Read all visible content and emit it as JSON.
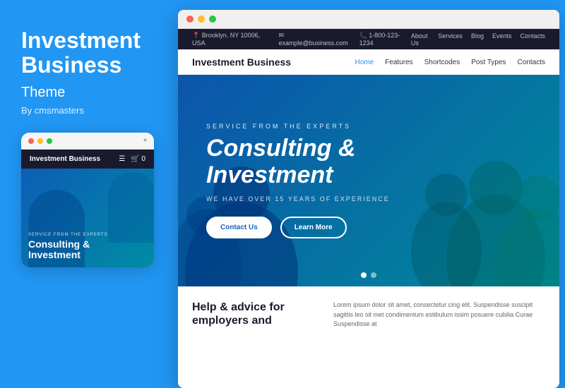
{
  "left": {
    "title": "Investment Business",
    "subtitle": "Theme",
    "by": "By cmsmasters"
  },
  "mobile": {
    "window_dots": [
      "red",
      "yellow",
      "green"
    ],
    "site_logo": "Investment Business",
    "menu_icon": "☰",
    "cart_text": "🛒 0",
    "hero_label": "SERVICE FROM THE EXPERTS",
    "hero_heading_line1": "Consulting &",
    "hero_heading_line2": "Investment"
  },
  "browser": {
    "window_dots": [
      "red",
      "yellow",
      "green"
    ],
    "topbar": {
      "left_items": [
        "📍 Brooklyn, NY 10006, USA",
        "✉ example@business.com",
        "📞 1-800-123-1234"
      ],
      "right_items": [
        "About Us",
        "Services",
        "Blog",
        "Events",
        "Contacts"
      ]
    },
    "nav": {
      "logo": "Investment Business",
      "links": [
        "Home",
        "Features",
        "Shortcodes",
        "Post Types",
        "Contacts"
      ]
    },
    "hero": {
      "label": "SERVICE FROM THE EXPERTS",
      "heading_line1": "Consulting &",
      "heading_line2": "Investment",
      "subtext": "WE HAVE OVER 15 YEARS OF EXPERIENCE",
      "btn_contact": "Contact Us",
      "btn_learn": "Learn More"
    },
    "bottom": {
      "heading": "Help & advice for employers and",
      "body_text": "Lorem ipsum dolor sit amet, consectetur cing elit. Suspendisse suscipit sagittis leo sit met condimentum estibulum issim posuere cubilia Curae Suspendisse at"
    }
  },
  "colors": {
    "blue_bg": "#2196f3",
    "dark_nav": "#1a1a2e",
    "hero_gradient_start": "#1565c0",
    "hero_gradient_end": "#00bfa5"
  }
}
